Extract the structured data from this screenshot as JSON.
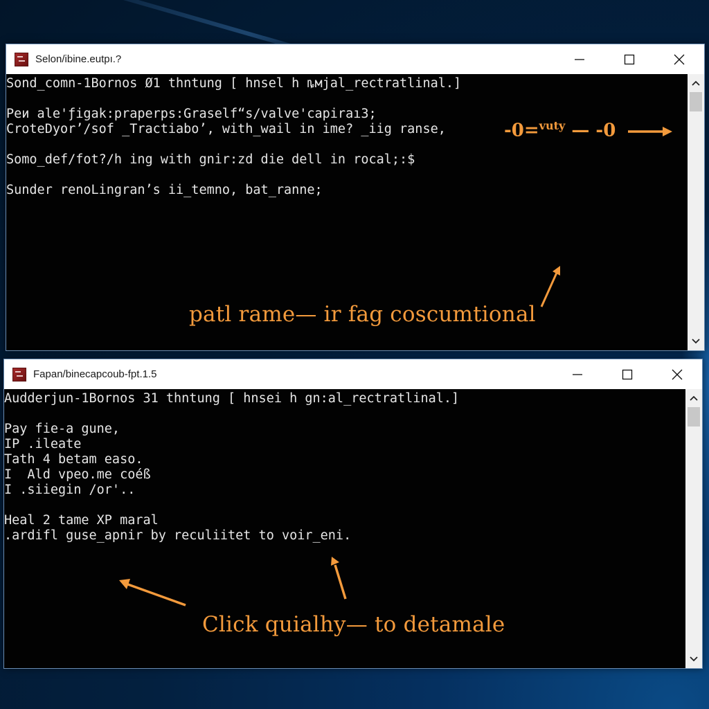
{
  "desktop": {
    "accent_color": "#f39a3c"
  },
  "window1": {
    "title": "Selon/ibine.eutpı.?",
    "controls": {
      "minimize": "minimize",
      "maximize": "maximize",
      "close": "close"
    },
    "lines": [
      "Sond_comn-1Bornos Ø1 thntung [ hnsel h ȵмjal_rectratlinal.]",
      "",
      "Peи ale'ƒigak:praperps:Graself“s/valve'capiraı3;",
      "CroteDyor’/sof ̲Tractiabo’, with_wail in ime? _iig ranse,",
      "",
      "Somo_def/fot?/h ing with gnir:zd die dell in rocal;:$",
      "",
      "Sunder renoLingran’s ii_temno, bat_ranne;"
    ],
    "annotation_top": {
      "part1": "-0=",
      "superscript": "vuty",
      "part2": "— -0"
    },
    "annotation_bottom": "patl rame— ir fag coscumtional"
  },
  "window2": {
    "title": "Fapan/binecapcoub-fpt.1.5",
    "controls": {
      "minimize": "minimize",
      "maximize": "maximize",
      "close": "close"
    },
    "lines": [
      "Audderjun-1Bornos 31 thntung [ hnsei h gn:al_rectratlinal.]",
      "",
      "Pay fie-a gune,",
      "IP .ileate",
      "Tath 4 betam easo.",
      "I  Ald vpeo.me coéß",
      "I .siiegin /or'..",
      "",
      "Heal 2 tame XP maral",
      ".ardifl guse_apnir by reculiitet to voir_eni."
    ],
    "annotation": "Click quialhy— to detamale"
  }
}
